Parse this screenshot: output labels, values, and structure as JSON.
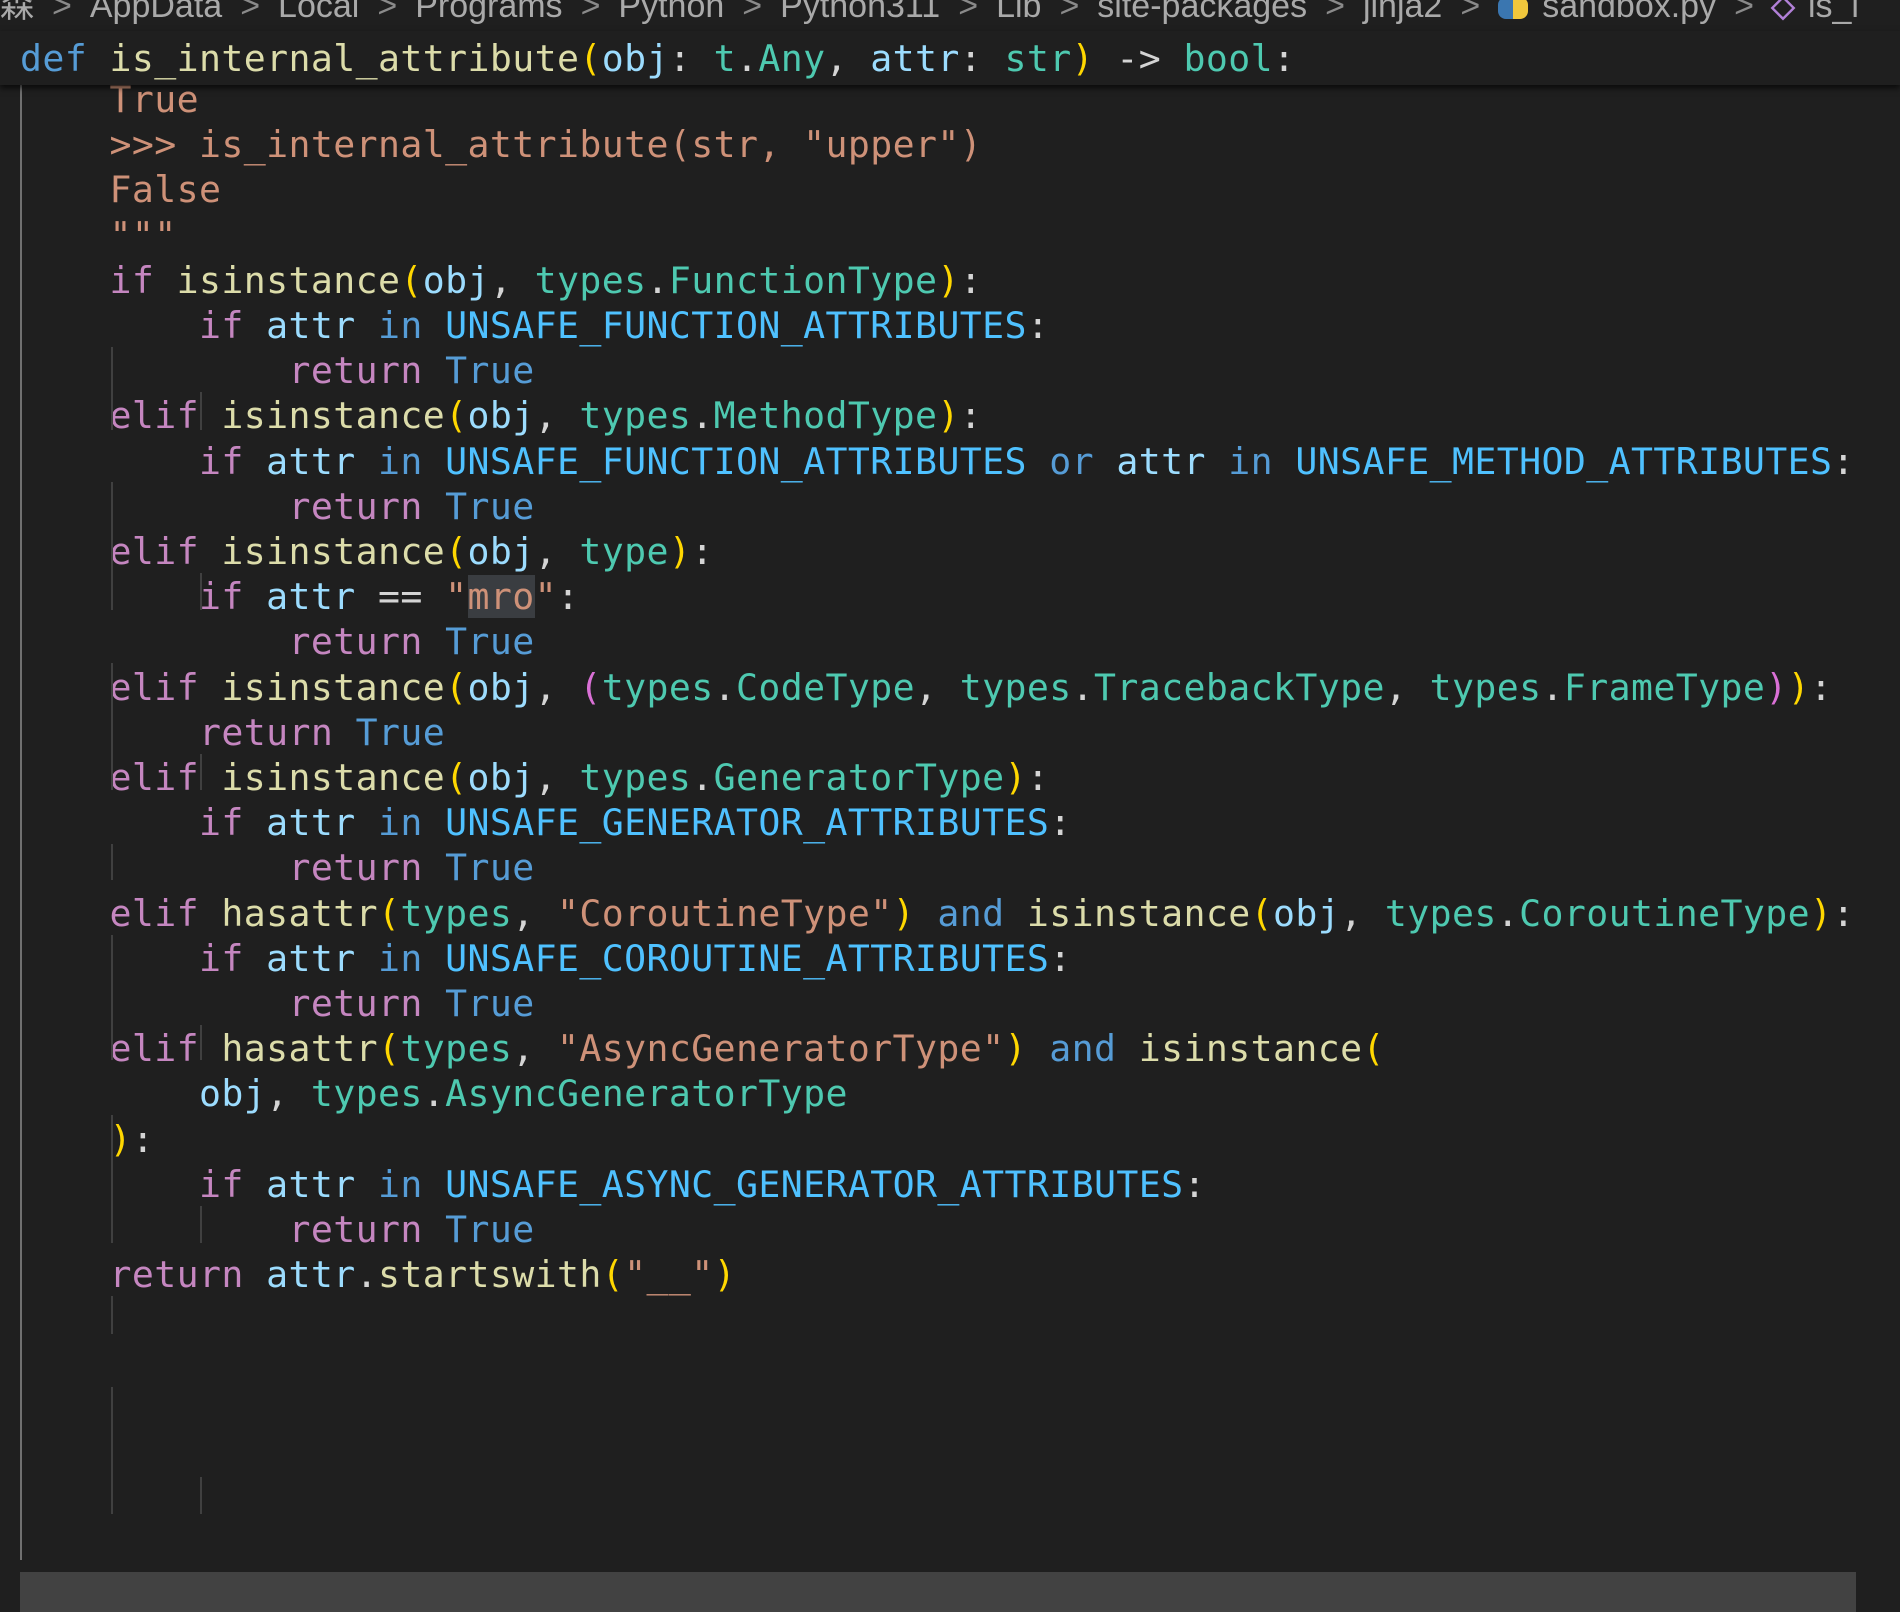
{
  "breadcrumb": {
    "items": [
      "森",
      "AppData",
      "Local",
      "Programs",
      "Python",
      "Python311",
      "Lib",
      "site-packages",
      "jinja2",
      "sandbox.py",
      "is_i"
    ],
    "separator": ">"
  },
  "editor": {
    "language": "python",
    "highlighted_token": "mro",
    "sticky_line": [
      {
        "t": "def",
        "c": "k"
      },
      {
        "t": " ",
        "c": "p"
      },
      {
        "t": "is_internal_attribute",
        "c": "fn"
      },
      {
        "t": "(",
        "c": "b1"
      },
      {
        "t": "obj",
        "c": "v"
      },
      {
        "t": ": ",
        "c": "p"
      },
      {
        "t": "t",
        "c": "ty"
      },
      {
        "t": ".",
        "c": "p"
      },
      {
        "t": "Any",
        "c": "ty"
      },
      {
        "t": ", ",
        "c": "p"
      },
      {
        "t": "attr",
        "c": "v"
      },
      {
        "t": ": ",
        "c": "p"
      },
      {
        "t": "str",
        "c": "ty"
      },
      {
        "t": ")",
        "c": "b1"
      },
      {
        "t": " -> ",
        "c": "p"
      },
      {
        "t": "bool",
        "c": "ty"
      },
      {
        "t": ":",
        "c": "p"
      }
    ],
    "lines": [
      [
        {
          "t": "    True",
          "c": "s"
        }
      ],
      [
        {
          "t": "    >>> is_internal_attribute(str, \"upper\")",
          "c": "s"
        }
      ],
      [
        {
          "t": "    False",
          "c": "s"
        }
      ],
      [
        {
          "t": "    \"\"\"",
          "c": "s"
        }
      ],
      [
        {
          "t": "    ",
          "c": "p"
        },
        {
          "t": "if",
          "c": "kc"
        },
        {
          "t": " ",
          "c": "p"
        },
        {
          "t": "isinstance",
          "c": "fn"
        },
        {
          "t": "(",
          "c": "b1"
        },
        {
          "t": "obj",
          "c": "v"
        },
        {
          "t": ", ",
          "c": "p"
        },
        {
          "t": "types",
          "c": "ty"
        },
        {
          "t": ".",
          "c": "p"
        },
        {
          "t": "FunctionType",
          "c": "ty"
        },
        {
          "t": ")",
          "c": "b1"
        },
        {
          "t": ":",
          "c": "p"
        }
      ],
      [
        {
          "t": "        ",
          "c": "p"
        },
        {
          "t": "if",
          "c": "kc"
        },
        {
          "t": " ",
          "c": "p"
        },
        {
          "t": "attr",
          "c": "v"
        },
        {
          "t": " ",
          "c": "p"
        },
        {
          "t": "in",
          "c": "k"
        },
        {
          "t": " ",
          "c": "p"
        },
        {
          "t": "UNSAFE_FUNCTION_ATTRIBUTES",
          "c": "cn"
        },
        {
          "t": ":",
          "c": "p"
        }
      ],
      [
        {
          "t": "            ",
          "c": "p"
        },
        {
          "t": "return",
          "c": "kc"
        },
        {
          "t": " ",
          "c": "p"
        },
        {
          "t": "True",
          "c": "bt"
        }
      ],
      [
        {
          "t": "    ",
          "c": "p"
        },
        {
          "t": "elif",
          "c": "kc"
        },
        {
          "t": " ",
          "c": "p"
        },
        {
          "t": "isinstance",
          "c": "fn"
        },
        {
          "t": "(",
          "c": "b1"
        },
        {
          "t": "obj",
          "c": "v"
        },
        {
          "t": ", ",
          "c": "p"
        },
        {
          "t": "types",
          "c": "ty"
        },
        {
          "t": ".",
          "c": "p"
        },
        {
          "t": "MethodType",
          "c": "ty"
        },
        {
          "t": ")",
          "c": "b1"
        },
        {
          "t": ":",
          "c": "p"
        }
      ],
      [
        {
          "t": "        ",
          "c": "p"
        },
        {
          "t": "if",
          "c": "kc"
        },
        {
          "t": " ",
          "c": "p"
        },
        {
          "t": "attr",
          "c": "v"
        },
        {
          "t": " ",
          "c": "p"
        },
        {
          "t": "in",
          "c": "k"
        },
        {
          "t": " ",
          "c": "p"
        },
        {
          "t": "UNSAFE_FUNCTION_ATTRIBUTES",
          "c": "cn"
        },
        {
          "t": " ",
          "c": "p"
        },
        {
          "t": "or",
          "c": "k"
        },
        {
          "t": " ",
          "c": "p"
        },
        {
          "t": "attr",
          "c": "v"
        },
        {
          "t": " ",
          "c": "p"
        },
        {
          "t": "in",
          "c": "k"
        },
        {
          "t": " ",
          "c": "p"
        },
        {
          "t": "UNSAFE_METHOD_ATTRIBUTES",
          "c": "cn"
        },
        {
          "t": ":",
          "c": "p"
        }
      ],
      [
        {
          "t": "            ",
          "c": "p"
        },
        {
          "t": "return",
          "c": "kc"
        },
        {
          "t": " ",
          "c": "p"
        },
        {
          "t": "True",
          "c": "bt"
        }
      ],
      [
        {
          "t": "    ",
          "c": "p"
        },
        {
          "t": "elif",
          "c": "kc"
        },
        {
          "t": " ",
          "c": "p"
        },
        {
          "t": "isinstance",
          "c": "fn"
        },
        {
          "t": "(",
          "c": "b1"
        },
        {
          "t": "obj",
          "c": "v"
        },
        {
          "t": ", ",
          "c": "p"
        },
        {
          "t": "type",
          "c": "ty"
        },
        {
          "t": ")",
          "c": "b1"
        },
        {
          "t": ":",
          "c": "p"
        }
      ],
      [
        {
          "t": "        ",
          "c": "p"
        },
        {
          "t": "if",
          "c": "kc"
        },
        {
          "t": " ",
          "c": "p"
        },
        {
          "t": "attr",
          "c": "v"
        },
        {
          "t": " == ",
          "c": "p"
        },
        {
          "t": "\"",
          "c": "s"
        },
        {
          "t": "mro",
          "c": "s hl"
        },
        {
          "t": "\"",
          "c": "s"
        },
        {
          "t": ":",
          "c": "p"
        }
      ],
      [
        {
          "t": "            ",
          "c": "p"
        },
        {
          "t": "return",
          "c": "kc"
        },
        {
          "t": " ",
          "c": "p"
        },
        {
          "t": "True",
          "c": "bt"
        }
      ],
      [
        {
          "t": "    ",
          "c": "p"
        },
        {
          "t": "elif",
          "c": "kc"
        },
        {
          "t": " ",
          "c": "p"
        },
        {
          "t": "isinstance",
          "c": "fn"
        },
        {
          "t": "(",
          "c": "b1"
        },
        {
          "t": "obj",
          "c": "v"
        },
        {
          "t": ", ",
          "c": "p"
        },
        {
          "t": "(",
          "c": "b2"
        },
        {
          "t": "types",
          "c": "ty"
        },
        {
          "t": ".",
          "c": "p"
        },
        {
          "t": "CodeType",
          "c": "ty"
        },
        {
          "t": ", ",
          "c": "p"
        },
        {
          "t": "types",
          "c": "ty"
        },
        {
          "t": ".",
          "c": "p"
        },
        {
          "t": "TracebackType",
          "c": "ty"
        },
        {
          "t": ", ",
          "c": "p"
        },
        {
          "t": "types",
          "c": "ty"
        },
        {
          "t": ".",
          "c": "p"
        },
        {
          "t": "FrameType",
          "c": "ty"
        },
        {
          "t": ")",
          "c": "b2"
        },
        {
          "t": ")",
          "c": "b1"
        },
        {
          "t": ":",
          "c": "p"
        }
      ],
      [
        {
          "t": "        ",
          "c": "p"
        },
        {
          "t": "return",
          "c": "kc"
        },
        {
          "t": " ",
          "c": "p"
        },
        {
          "t": "True",
          "c": "bt"
        }
      ],
      [
        {
          "t": "    ",
          "c": "p"
        },
        {
          "t": "elif",
          "c": "kc"
        },
        {
          "t": " ",
          "c": "p"
        },
        {
          "t": "isinstance",
          "c": "fn"
        },
        {
          "t": "(",
          "c": "b1"
        },
        {
          "t": "obj",
          "c": "v"
        },
        {
          "t": ", ",
          "c": "p"
        },
        {
          "t": "types",
          "c": "ty"
        },
        {
          "t": ".",
          "c": "p"
        },
        {
          "t": "GeneratorType",
          "c": "ty"
        },
        {
          "t": ")",
          "c": "b1"
        },
        {
          "t": ":",
          "c": "p"
        }
      ],
      [
        {
          "t": "        ",
          "c": "p"
        },
        {
          "t": "if",
          "c": "kc"
        },
        {
          "t": " ",
          "c": "p"
        },
        {
          "t": "attr",
          "c": "v"
        },
        {
          "t": " ",
          "c": "p"
        },
        {
          "t": "in",
          "c": "k"
        },
        {
          "t": " ",
          "c": "p"
        },
        {
          "t": "UNSAFE_GENERATOR_ATTRIBUTES",
          "c": "cn"
        },
        {
          "t": ":",
          "c": "p"
        }
      ],
      [
        {
          "t": "            ",
          "c": "p"
        },
        {
          "t": "return",
          "c": "kc"
        },
        {
          "t": " ",
          "c": "p"
        },
        {
          "t": "True",
          "c": "bt"
        }
      ],
      [
        {
          "t": "    ",
          "c": "p"
        },
        {
          "t": "elif",
          "c": "kc"
        },
        {
          "t": " ",
          "c": "p"
        },
        {
          "t": "hasattr",
          "c": "fn"
        },
        {
          "t": "(",
          "c": "b1"
        },
        {
          "t": "types",
          "c": "ty"
        },
        {
          "t": ", ",
          "c": "p"
        },
        {
          "t": "\"CoroutineType\"",
          "c": "s"
        },
        {
          "t": ")",
          "c": "b1"
        },
        {
          "t": " ",
          "c": "p"
        },
        {
          "t": "and",
          "c": "k"
        },
        {
          "t": " ",
          "c": "p"
        },
        {
          "t": "isinstance",
          "c": "fn"
        },
        {
          "t": "(",
          "c": "b1"
        },
        {
          "t": "obj",
          "c": "v"
        },
        {
          "t": ", ",
          "c": "p"
        },
        {
          "t": "types",
          "c": "ty"
        },
        {
          "t": ".",
          "c": "p"
        },
        {
          "t": "CoroutineType",
          "c": "ty"
        },
        {
          "t": ")",
          "c": "b1"
        },
        {
          "t": ":",
          "c": "p"
        }
      ],
      [
        {
          "t": "        ",
          "c": "p"
        },
        {
          "t": "if",
          "c": "kc"
        },
        {
          "t": " ",
          "c": "p"
        },
        {
          "t": "attr",
          "c": "v"
        },
        {
          "t": " ",
          "c": "p"
        },
        {
          "t": "in",
          "c": "k"
        },
        {
          "t": " ",
          "c": "p"
        },
        {
          "t": "UNSAFE_COROUTINE_ATTRIBUTES",
          "c": "cn"
        },
        {
          "t": ":",
          "c": "p"
        }
      ],
      [
        {
          "t": "            ",
          "c": "p"
        },
        {
          "t": "return",
          "c": "kc"
        },
        {
          "t": " ",
          "c": "p"
        },
        {
          "t": "True",
          "c": "bt"
        }
      ],
      [
        {
          "t": "    ",
          "c": "p"
        },
        {
          "t": "elif",
          "c": "kc"
        },
        {
          "t": " ",
          "c": "p"
        },
        {
          "t": "hasattr",
          "c": "fn"
        },
        {
          "t": "(",
          "c": "b1"
        },
        {
          "t": "types",
          "c": "ty"
        },
        {
          "t": ", ",
          "c": "p"
        },
        {
          "t": "\"AsyncGeneratorType\"",
          "c": "s"
        },
        {
          "t": ")",
          "c": "b1"
        },
        {
          "t": " ",
          "c": "p"
        },
        {
          "t": "and",
          "c": "k"
        },
        {
          "t": " ",
          "c": "p"
        },
        {
          "t": "isinstance",
          "c": "fn"
        },
        {
          "t": "(",
          "c": "b1"
        }
      ],
      [
        {
          "t": "        ",
          "c": "p"
        },
        {
          "t": "obj",
          "c": "v"
        },
        {
          "t": ", ",
          "c": "p"
        },
        {
          "t": "types",
          "c": "ty"
        },
        {
          "t": ".",
          "c": "p"
        },
        {
          "t": "AsyncGeneratorType",
          "c": "ty"
        }
      ],
      [
        {
          "t": "    ",
          "c": "p"
        },
        {
          "t": ")",
          "c": "b1"
        },
        {
          "t": ":",
          "c": "p"
        }
      ],
      [
        {
          "t": "        ",
          "c": "p"
        },
        {
          "t": "if",
          "c": "kc"
        },
        {
          "t": " ",
          "c": "p"
        },
        {
          "t": "attr",
          "c": "v"
        },
        {
          "t": " ",
          "c": "p"
        },
        {
          "t": "in",
          "c": "k"
        },
        {
          "t": " ",
          "c": "p"
        },
        {
          "t": "UNSAFE_ASYNC_GENERATOR_ATTRIBUTES",
          "c": "cn"
        },
        {
          "t": ":",
          "c": "p"
        }
      ],
      [
        {
          "t": "            ",
          "c": "p"
        },
        {
          "t": "return",
          "c": "kc"
        },
        {
          "t": " ",
          "c": "p"
        },
        {
          "t": "True",
          "c": "bt"
        }
      ],
      [
        {
          "t": "    ",
          "c": "p"
        },
        {
          "t": "return",
          "c": "kc"
        },
        {
          "t": " ",
          "c": "p"
        },
        {
          "t": "attr",
          "c": "v"
        },
        {
          "t": ".",
          "c": "p"
        },
        {
          "t": "startswith",
          "c": "fn"
        },
        {
          "t": "(",
          "c": "b1"
        },
        {
          "t": "\"__\"",
          "c": "s"
        },
        {
          "t": ")",
          "c": "b1"
        }
      ]
    ]
  }
}
